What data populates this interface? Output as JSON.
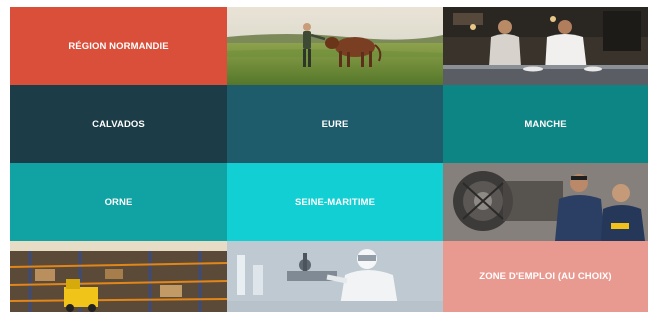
{
  "tiles": {
    "region": "RÉGION NORMANDIE",
    "calvados": "CALVADOS",
    "eure": "EURE",
    "manche": "MANCHE",
    "orne": "ORNE",
    "seine_maritime": "SEINE-MARITIME",
    "zone_emploi": "ZONE D'EMPLOI (AU CHOIX)"
  },
  "colors": {
    "region": "#d94f3a",
    "calvados": "#1c3c47",
    "eure": "#1e5b6b",
    "manche": "#0e8585",
    "orne": "#11a3a4",
    "seine_maritime": "#11cfd3",
    "zone_emploi": "#e99a90"
  },
  "images": {
    "farm": "farm-cow-photo",
    "kitchen": "chefs-kitchen-photo",
    "engine": "engine-technicians-photo",
    "warehouse": "warehouse-forklift-photo",
    "lab": "laboratory-scientist-photo"
  }
}
